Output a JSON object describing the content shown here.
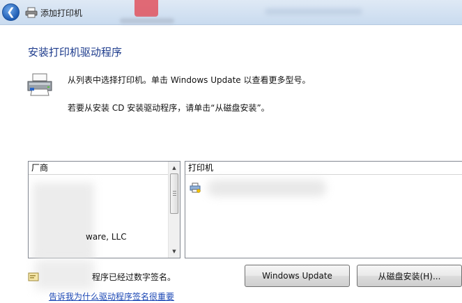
{
  "window": {
    "title": "添加打印机"
  },
  "page": {
    "heading": "安装打印机驱动程序",
    "instruction_1": "从列表中选择打印机。单击 Windows Update 以查看更多型号。",
    "instruction_2": "若要从安装 CD 安装驱动程序，请单击“从磁盘安装”。"
  },
  "manufacturer_list": {
    "header": "厂商",
    "items": [
      "ware, LLC"
    ]
  },
  "printer_list": {
    "header": "打印机"
  },
  "signature": {
    "text": "程序已经过数字签名。",
    "link": "告诉我为什么驱动程序签名很重要"
  },
  "buttons": {
    "windows_update": "Windows Update",
    "from_disk": "从磁盘安装(H)..."
  },
  "colors": {
    "heading": "#1d3b8c",
    "link": "#1a46b4"
  }
}
